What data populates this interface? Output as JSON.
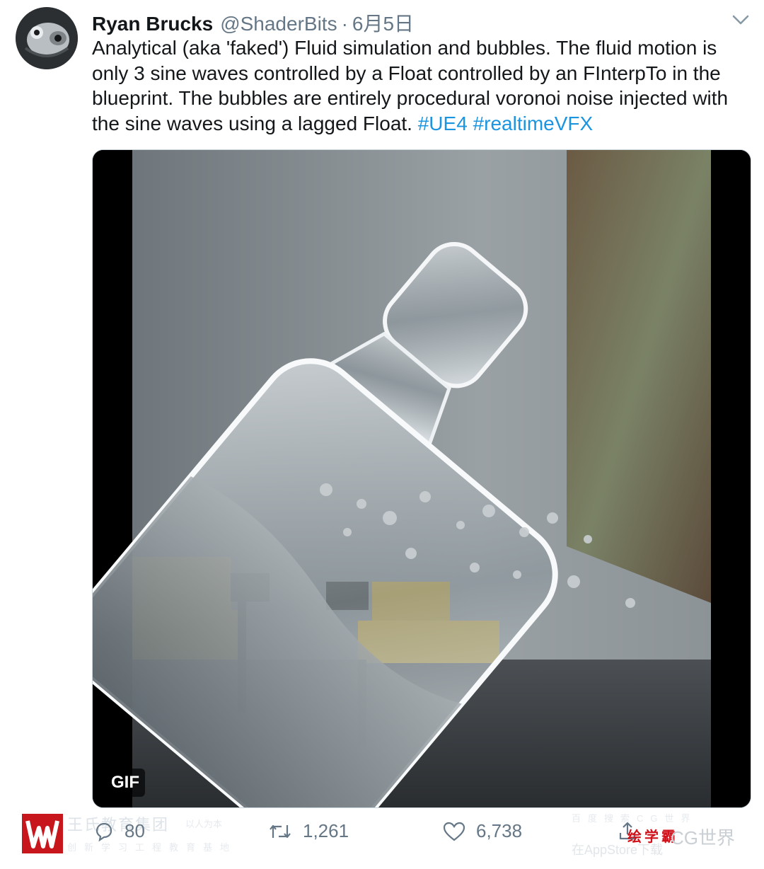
{
  "tweet": {
    "author_name": "Ryan Brucks",
    "handle": "@ShaderBits",
    "separator": "·",
    "date": "6月5日",
    "text_main": "Analytical (aka 'faked') Fluid simulation and bubbles.  The fluid motion is only 3 sine waves controlled by a Float controlled by an FInterpTo in the blueprint. The bubbles are entirely procedural voronoi noise injected with the sine waves using a lagged Float.",
    "hashtags": [
      "#UE4",
      "#realtimeVFX"
    ]
  },
  "media": {
    "badge": "GIF"
  },
  "actions": {
    "replies": "80",
    "retweets": "1,261",
    "likes": "6,738"
  },
  "watermark": {
    "left_title": "王氏教育集团",
    "left_slogan": "以人为本",
    "left_sub": "创新学习工程教育基地",
    "right_top": "百度搜索CG世界",
    "right_brand": "绘学霸",
    "right_cg": "CG世界",
    "right_app": "在AppStore下载"
  },
  "colors": {
    "link": "#1b95e0",
    "muted": "#657786",
    "watermark_red": "#c8161d"
  }
}
